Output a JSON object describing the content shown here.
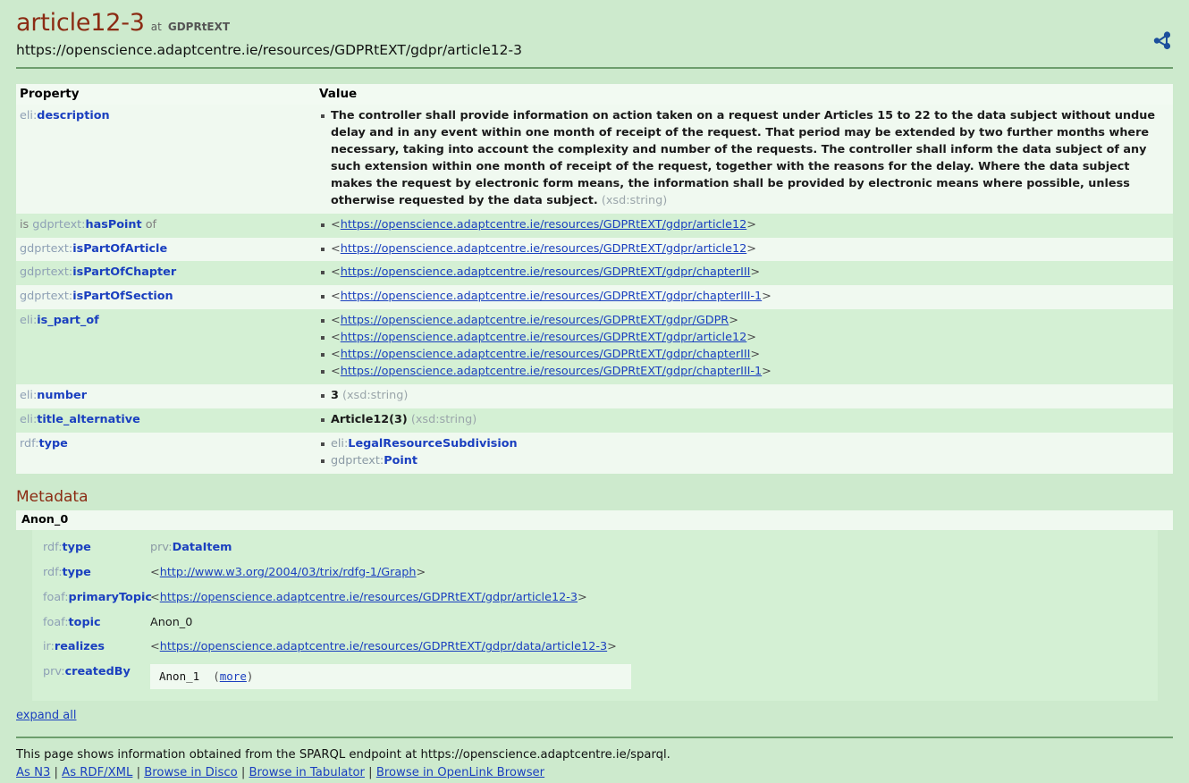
{
  "header": {
    "title": "article12-3",
    "at_word": "at",
    "source": "GDPRtEXT",
    "uri": "https://openscience.adaptcentre.ie/resources/GDPRtEXT/gdpr/article12-3",
    "share_icon": "share-network-icon"
  },
  "table": {
    "col_property": "Property",
    "col_value": "Value",
    "rows": [
      {
        "prefix": "eli:",
        "local": "description",
        "inverse_pre": "",
        "inverse_post": "",
        "values": [
          {
            "kind": "literal",
            "text": "The controller shall provide information on action taken on a request under Articles 15 to 22 to the data subject without undue delay and in any event within one month of receipt of the request. That period may be extended by two further months where necessary, taking into account the complexity and number of the requests. The controller shall inform the data subject of any such extension within one month of receipt of the request, together with the reasons for the delay. Where the data subject makes the request by electronic form means, the information shall be provided by electronic means where possible, unless otherwise requested by the data subject.",
            "datatype": "(xsd:string)"
          }
        ]
      },
      {
        "prefix": "gdprtext:",
        "local": "hasPoint",
        "inverse_pre": "is ",
        "inverse_post": " of",
        "values": [
          {
            "kind": "uri",
            "text": "https://openscience.adaptcentre.ie/resources/GDPRtEXT/gdpr/article12"
          }
        ]
      },
      {
        "prefix": "gdprtext:",
        "local": "isPartOfArticle",
        "inverse_pre": "",
        "inverse_post": "",
        "values": [
          {
            "kind": "uri",
            "text": "https://openscience.adaptcentre.ie/resources/GDPRtEXT/gdpr/article12"
          }
        ]
      },
      {
        "prefix": "gdprtext:",
        "local": "isPartOfChapter",
        "inverse_pre": "",
        "inverse_post": "",
        "values": [
          {
            "kind": "uri",
            "text": "https://openscience.adaptcentre.ie/resources/GDPRtEXT/gdpr/chapterIII"
          }
        ]
      },
      {
        "prefix": "gdprtext:",
        "local": "isPartOfSection",
        "inverse_pre": "",
        "inverse_post": "",
        "values": [
          {
            "kind": "uri",
            "text": "https://openscience.adaptcentre.ie/resources/GDPRtEXT/gdpr/chapterIII-1"
          }
        ]
      },
      {
        "prefix": "eli:",
        "local": "is_part_of",
        "inverse_pre": "",
        "inverse_post": "",
        "values": [
          {
            "kind": "uri",
            "text": "https://openscience.adaptcentre.ie/resources/GDPRtEXT/gdpr/GDPR"
          },
          {
            "kind": "uri",
            "text": "https://openscience.adaptcentre.ie/resources/GDPRtEXT/gdpr/article12"
          },
          {
            "kind": "uri",
            "text": "https://openscience.adaptcentre.ie/resources/GDPRtEXT/gdpr/chapterIII"
          },
          {
            "kind": "uri",
            "text": "https://openscience.adaptcentre.ie/resources/GDPRtEXT/gdpr/chapterIII-1"
          }
        ]
      },
      {
        "prefix": "eli:",
        "local": "number",
        "inverse_pre": "",
        "inverse_post": "",
        "values": [
          {
            "kind": "literal",
            "text": "3",
            "datatype": "(xsd:string)"
          }
        ]
      },
      {
        "prefix": "eli:",
        "local": "title_alternative",
        "inverse_pre": "",
        "inverse_post": "",
        "values": [
          {
            "kind": "literal",
            "text": "Article12(3)",
            "datatype": "(xsd:string)"
          }
        ]
      },
      {
        "prefix": "rdf:",
        "local": "type",
        "inverse_pre": "",
        "inverse_post": "",
        "values": [
          {
            "kind": "qname",
            "prefix": "eli:",
            "local": "LegalResourceSubdivision"
          },
          {
            "kind": "qname",
            "prefix": "gdprtext:",
            "local": "Point"
          }
        ]
      }
    ]
  },
  "metadata": {
    "heading": "Metadata",
    "node_label": "Anon_0",
    "rows": [
      {
        "prefix": "rdf:",
        "local": "type",
        "value_kind": "qname",
        "value_prefix": "prv:",
        "value_local": "DataItem"
      },
      {
        "prefix": "rdf:",
        "local": "type",
        "value_kind": "uri",
        "value": "http://www.w3.org/2004/03/trix/rdfg-1/Graph"
      },
      {
        "prefix": "foaf:",
        "local": "primaryTopic",
        "value_kind": "uri",
        "value": "https://openscience.adaptcentre.ie/resources/GDPRtEXT/gdpr/article12-3"
      },
      {
        "prefix": "foaf:",
        "local": "topic",
        "value_kind": "plain",
        "value": "Anon_0"
      },
      {
        "prefix": "ir:",
        "local": "realizes",
        "value_kind": "uri",
        "value": "https://openscience.adaptcentre.ie/resources/GDPRtEXT/gdpr/data/article12-3"
      },
      {
        "prefix": "prv:",
        "local": "createdBy",
        "value_kind": "nested",
        "value": "Anon_1",
        "more_open": "(",
        "more_label": "more",
        "more_close": ")"
      }
    ]
  },
  "expand_all": "expand all",
  "footer": {
    "note": "This page shows information obtained from the SPARQL endpoint at https://openscience.adaptcentre.ie/sparql.",
    "links": [
      "As N3",
      "As RDF/XML",
      "Browse in Disco",
      "Browse in Tabulator",
      "Browse in OpenLink Browser"
    ],
    "separator": "|"
  }
}
